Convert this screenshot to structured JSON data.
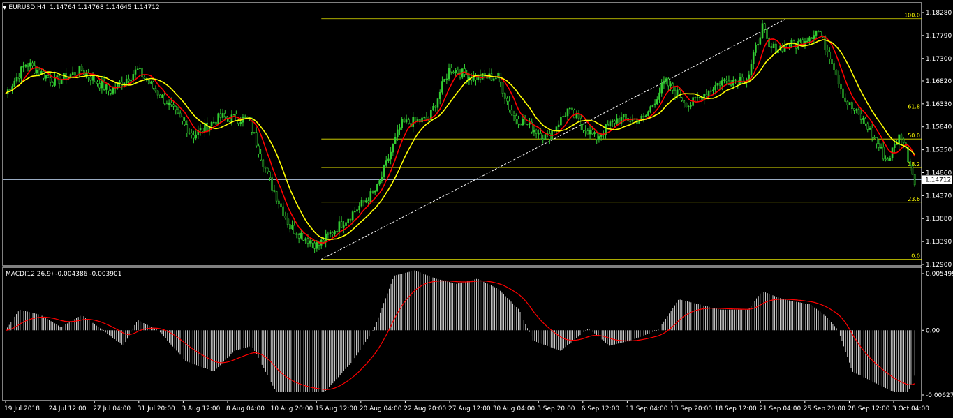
{
  "header": {
    "symbol_tf": "EURUSD,H4",
    "ohlc": "1.14764 1.14768 1.14645 1.14712"
  },
  "macd": {
    "label": "MACD(12,26,9) -0.004386 -0.003901",
    "axis_ticks": [
      "0.005499",
      "0.00",
      "-0.006272"
    ],
    "tick_values": [
      0.005499,
      0,
      -0.006272
    ]
  },
  "colors": {
    "background": "#000000",
    "frame": "#ffffff",
    "candle": "#32cd32",
    "ma_fast": "#ff0000",
    "ma_slow": "#ffff00",
    "fibo": "#ffff00",
    "trendline": "#ffffff",
    "price_line": "#b0c4de",
    "macd_hist": "#ffffff",
    "macd_signal": "#ff0000"
  },
  "chart_data": {
    "type": "candlestick",
    "symbol": "EURUSD",
    "timeframe": "H4",
    "price_axis_ticks": [
      "1.18280",
      "1.17790",
      "1.17300",
      "1.16820",
      "1.16330",
      "1.15840",
      "1.15350",
      "1.14860",
      "1.14370",
      "1.13880",
      "1.13390",
      "1.12900"
    ],
    "price_axis_values": [
      1.1828,
      1.1779,
      1.173,
      1.1682,
      1.1633,
      1.1584,
      1.1535,
      1.1486,
      1.1437,
      1.1388,
      1.1339,
      1.129
    ],
    "ylim": [
      1.129,
      1.1828
    ],
    "current_price": "1.14712",
    "x_labels": [
      "19 Jul 2018",
      "24 Jul 12:00",
      "27 Jul 04:00",
      "31 Jul 20:00",
      "3 Aug 12:00",
      "8 Aug 04:00",
      "10 Aug 20:00",
      "15 Aug 12:00",
      "20 Aug 04:00",
      "22 Aug 20:00",
      "27 Aug 12:00",
      "30 Aug 04:00",
      "3 Sep 20:00",
      "6 Sep 12:00",
      "11 Sep 04:00",
      "13 Sep 20:00",
      "18 Sep 12:00",
      "21 Sep 04:00",
      "25 Sep 20:00",
      "28 Sep 12:00",
      "3 Oct 04:00"
    ],
    "price_path": [
      [
        0,
        1.1655
      ],
      [
        0.03,
        1.172
      ],
      [
        0.07,
        1.168
      ],
      [
        0.11,
        1.1705
      ],
      [
        0.15,
        1.166
      ],
      [
        0.19,
        1.1705
      ],
      [
        0.23,
        1.164
      ],
      [
        0.27,
        1.1565
      ],
      [
        0.31,
        1.1605
      ],
      [
        0.35,
        1.16
      ],
      [
        0.38,
        1.147
      ],
      [
        0.41,
        1.137
      ],
      [
        0.45,
        1.133
      ],
      [
        0.5,
        1.14
      ],
      [
        0.535,
        1.145
      ],
      [
        0.57,
        1.159
      ],
      [
        0.61,
        1.16
      ],
      [
        0.64,
        1.171
      ],
      [
        0.67,
        1.169
      ],
      [
        0.71,
        1.169
      ],
      [
        0.73,
        1.161
      ],
      [
        0.78,
        1.156
      ],
      [
        0.81,
        1.162
      ],
      [
        0.85,
        1.156
      ],
      [
        0.88,
        1.16
      ],
      [
        0.92,
        1.16
      ],
      [
        0.95,
        1.168
      ],
      [
        0.985,
        1.163
      ],
      [
        1.03,
        1.168
      ],
      [
        1.07,
        1.169
      ],
      [
        1.09,
        1.18
      ],
      [
        1.1,
        1.175
      ],
      [
        1.14,
        1.176
      ],
      [
        1.17,
        1.179
      ],
      [
        1.19,
        1.173
      ],
      [
        1.21,
        1.164
      ],
      [
        1.24,
        1.159
      ],
      [
        1.27,
        1.151
      ],
      [
        1.29,
        1.157
      ],
      [
        1.31,
        1.1471
      ]
    ],
    "trendline": {
      "from": [
        "15 Aug 12:00",
        1.1301
      ],
      "to": [
        "21 Sep 04:00",
        1.1815
      ]
    },
    "fibonacci": [
      {
        "label": "100.0",
        "price": 1.1815
      },
      {
        "label": "61.8",
        "price": 1.162
      },
      {
        "label": "50.0",
        "price": 1.1558
      },
      {
        "label": "38.2",
        "price": 1.1497
      },
      {
        "label": "23.6",
        "price": 1.1423
      },
      {
        "label": "0.0",
        "price": 1.1301
      }
    ],
    "macd_path": [
      [
        0,
        0.0
      ],
      [
        0.02,
        0.002
      ],
      [
        0.05,
        0.0015
      ],
      [
        0.08,
        0.0003
      ],
      [
        0.11,
        0.0015
      ],
      [
        0.14,
        0.0
      ],
      [
        0.17,
        -0.0015
      ],
      [
        0.19,
        0.001
      ],
      [
        0.22,
        0.0
      ],
      [
        0.26,
        -0.003
      ],
      [
        0.3,
        -0.004
      ],
      [
        0.33,
        -0.002
      ],
      [
        0.355,
        -0.0015
      ],
      [
        0.39,
        -0.006
      ],
      [
        0.42,
        -0.006
      ],
      [
        0.46,
        -0.006
      ],
      [
        0.5,
        -0.003
      ],
      [
        0.53,
        0.0
      ],
      [
        0.56,
        0.0053
      ],
      [
        0.59,
        0.0058
      ],
      [
        0.62,
        0.005
      ],
      [
        0.65,
        0.0045
      ],
      [
        0.68,
        0.005
      ],
      [
        0.71,
        0.004
      ],
      [
        0.74,
        0.002
      ],
      [
        0.76,
        -0.001
      ],
      [
        0.8,
        -0.002
      ],
      [
        0.84,
        0.0002
      ],
      [
        0.87,
        -0.0015
      ],
      [
        0.9,
        -0.001
      ],
      [
        0.94,
        0.0
      ],
      [
        0.97,
        0.003
      ],
      [
        1.0,
        0.0025
      ],
      [
        1.03,
        0.002
      ],
      [
        1.07,
        0.002
      ],
      [
        1.09,
        0.0038
      ],
      [
        1.12,
        0.003
      ],
      [
        1.16,
        0.0025
      ],
      [
        1.18,
        0.0015
      ],
      [
        1.2,
        0.0
      ],
      [
        1.22,
        -0.004
      ],
      [
        1.25,
        -0.005
      ],
      [
        1.28,
        -0.006
      ],
      [
        1.3,
        -0.006
      ],
      [
        1.31,
        -0.0044
      ]
    ]
  }
}
